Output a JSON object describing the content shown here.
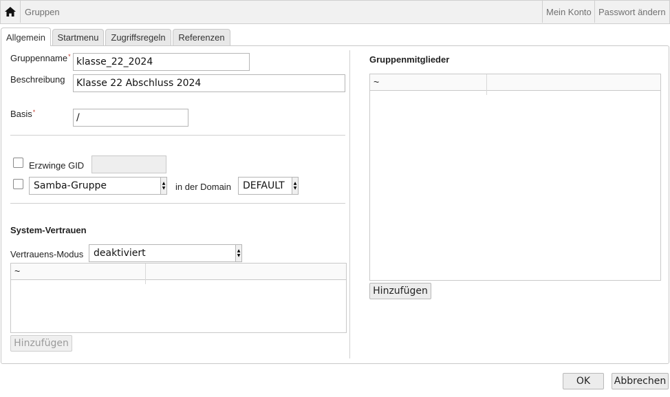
{
  "topbar": {
    "home_icon": "home-icon",
    "title": "Gruppen",
    "my_account": "Mein Konto",
    "change_password": "Passwort ändern"
  },
  "tabs": [
    {
      "label": "Allgemein",
      "active": true
    },
    {
      "label": "Startmenu",
      "active": false
    },
    {
      "label": "Zugriffsregeln",
      "active": false
    },
    {
      "label": "Referenzen",
      "active": false
    }
  ],
  "form": {
    "groupname_label": "Gruppenname",
    "groupname_value": "klasse_22_2024",
    "description_label": "Beschreibung",
    "description_value": "Klasse 22 Abschluss 2024",
    "base_label": "Basis",
    "base_value": "/",
    "required_mark": "*",
    "force_gid_label": "Erzwinge GID",
    "force_gid_value": "",
    "samba_type_value": "Samba-Gruppe",
    "in_domain_label": "in der Domain",
    "domain_value": "DEFAULT"
  },
  "trust": {
    "heading": "System-Vertrauen",
    "mode_label": "Vertrauens-Modus",
    "mode_value": "deaktiviert",
    "grid_sort_symbol": "~",
    "add_button": "Hinzufügen"
  },
  "members": {
    "heading": "Gruppenmitglieder",
    "grid_sort_symbol": "~",
    "add_button": "Hinzufügen"
  },
  "footer": {
    "ok": "OK",
    "cancel": "Abbrechen"
  },
  "colors": {
    "required": "#c0392b",
    "topbar_bg": "#f1f1f1",
    "border": "#c8c8c8"
  }
}
